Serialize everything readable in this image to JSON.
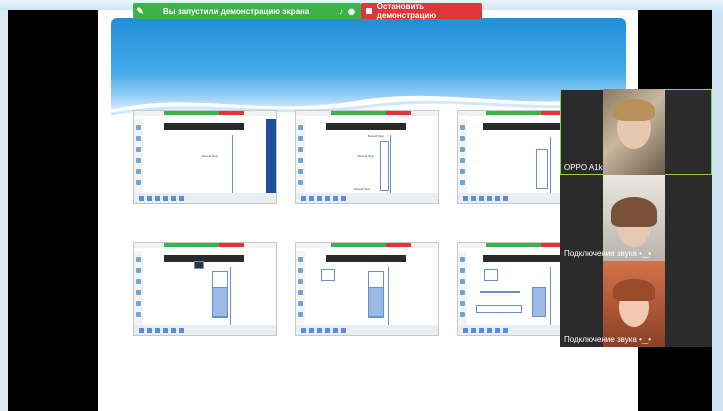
{
  "share_bar": {
    "status_text": "Вы запустили демонстрацию экрана",
    "stop_label": "Остановить демонстрацию"
  },
  "thumbnails": [
    {
      "labels": [
        "Белый брат"
      ]
    },
    {
      "labels": [
        "Белый брат",
        "Белый брат",
        "Белый брат"
      ]
    },
    {
      "labels": []
    },
    {
      "labels": []
    },
    {
      "labels": []
    },
    {
      "labels": []
    }
  ],
  "participants": [
    {
      "name": "OPPO A1k",
      "active": true
    },
    {
      "name": "Подключение звука",
      "connecting": true
    },
    {
      "name": "Подключение звука",
      "connecting": true
    }
  ],
  "colors": {
    "share_green": "#3cb34a",
    "stop_red": "#e0353b",
    "sky_blue": "#1f8fd8",
    "active_speaker": "#8ad44b"
  },
  "icons": [
    "pin-icon",
    "mic-icon",
    "shield-icon",
    "stop-square-icon"
  ]
}
